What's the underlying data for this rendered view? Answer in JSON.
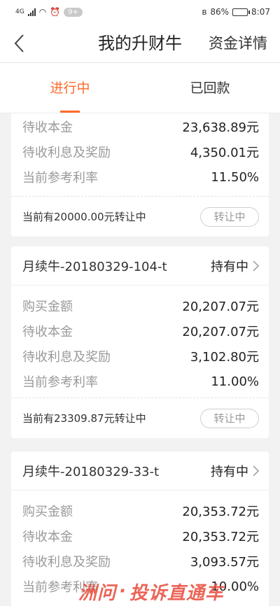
{
  "status_bar": {
    "network": "4G",
    "notification_badge": "9+",
    "battery_percent": "86%",
    "time": "8:07"
  },
  "nav": {
    "title": "我的升财牛",
    "right_link": "资金详情"
  },
  "tabs": [
    {
      "label": "进行中",
      "active": true
    },
    {
      "label": "已回款",
      "active": false
    }
  ],
  "cards": [
    {
      "rows": [
        {
          "label": "待收本金",
          "value": "23,638.89元"
        },
        {
          "label": "待收利息及奖励",
          "value": "4,350.01元"
        },
        {
          "label": "当前参考利率",
          "value": "11.50%"
        }
      ],
      "transfer_text": "当前有20000.00元转让中",
      "transfer_button": "转让中"
    },
    {
      "name": "月续牛-20180329-104-t",
      "status": "持有中",
      "rows": [
        {
          "label": "购买金额",
          "value": "20,207.07元"
        },
        {
          "label": "待收本金",
          "value": "20,207.07元"
        },
        {
          "label": "待收利息及奖励",
          "value": "3,102.80元"
        },
        {
          "label": "当前参考利率",
          "value": "11.00%"
        }
      ],
      "transfer_text": "当前有23309.87元转让中",
      "transfer_button": "转让中"
    },
    {
      "name": "月续牛-20180329-33-t",
      "status": "持有中",
      "rows": [
        {
          "label": "购买金额",
          "value": "20,353.72元"
        },
        {
          "label": "待收本金",
          "value": "20,353.72元"
        },
        {
          "label": "待收利息及奖励",
          "value": "3,093.57元"
        },
        {
          "label": "当前参考利率",
          "value": "10.00%"
        }
      ]
    }
  ],
  "watermark": {
    "left": "洲问",
    "right": "投诉直通车"
  },
  "colors": {
    "accent": "#ff6a2b",
    "background": "#f2f2f2",
    "label_gray": "#9a9a9a"
  }
}
